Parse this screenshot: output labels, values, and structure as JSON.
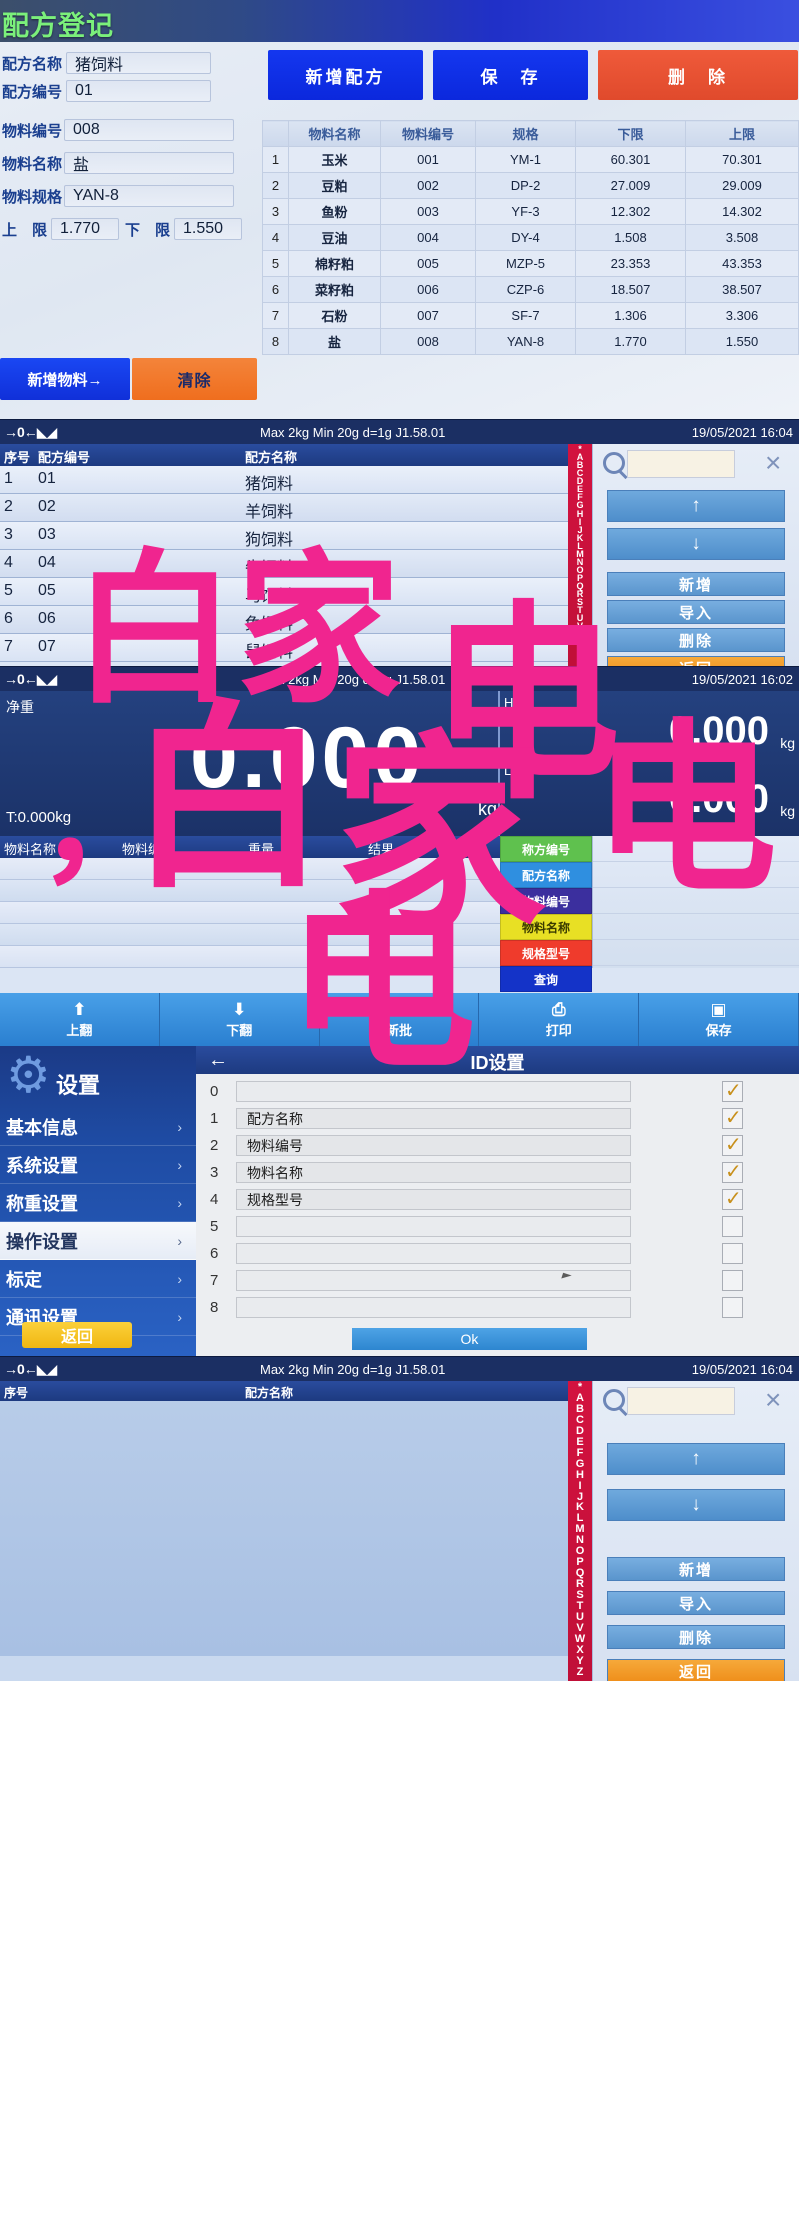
{
  "panel1": {
    "title": "配方登记",
    "fields": {
      "recipe_name_label": "配方名称",
      "recipe_name_value": "猪饲料",
      "recipe_code_label": "配方编号",
      "recipe_code_value": "01",
      "mat_code_label": "物料编号",
      "mat_code_value": "008",
      "mat_name_label": "物料名称",
      "mat_name_value": "盐",
      "mat_spec_label": "物料规格",
      "mat_spec_value": "YAN-8",
      "upper_label": "上　限",
      "upper_value": "1.770",
      "lower_label": "下　限",
      "lower_value": "1.550"
    },
    "buttons": {
      "new_recipe": "新增配方",
      "save": "保　存",
      "delete": "删　除",
      "new_material": "新增物料→",
      "clear": "清除"
    },
    "table": {
      "headers": [
        "",
        "物料名称",
        "物料编号",
        "规格",
        "下限",
        "上限"
      ],
      "rows": [
        [
          "1",
          "玉米",
          "001",
          "YM-1",
          "60.301",
          "70.301"
        ],
        [
          "2",
          "豆粕",
          "002",
          "DP-2",
          "27.009",
          "29.009"
        ],
        [
          "3",
          "鱼粉",
          "003",
          "YF-3",
          "12.302",
          "14.302"
        ],
        [
          "4",
          "豆油",
          "004",
          "DY-4",
          "1.508",
          "3.508"
        ],
        [
          "5",
          "棉籽粕",
          "005",
          "MZP-5",
          "23.353",
          "43.353"
        ],
        [
          "6",
          "菜籽粕",
          "006",
          "CZP-6",
          "18.507",
          "38.507"
        ],
        [
          "7",
          "石粉",
          "007",
          "SF-7",
          "1.306",
          "3.306"
        ],
        [
          "8",
          "盐",
          "008",
          "YAN-8",
          "1.770",
          "1.550"
        ]
      ]
    }
  },
  "statusbar": {
    "zero_icon": "→0←◣◢",
    "spec": "Max 2kg  Min 20g  d=1g    J1.58.01",
    "datetime": "19/05/2021  16:04",
    "datetime2": "19/05/2021  16:02"
  },
  "panel2": {
    "headers": {
      "seq": "序号",
      "code": "配方编号",
      "name": "配方名称"
    },
    "rows": [
      [
        "1",
        "01",
        "猪饲料"
      ],
      [
        "2",
        "02",
        "羊饲料"
      ],
      [
        "3",
        "03",
        "狗饲料"
      ],
      [
        "4",
        "04",
        "牛饲料"
      ],
      [
        "5",
        "05",
        "马饲料"
      ],
      [
        "6",
        "06",
        "兔饲料"
      ],
      [
        "7",
        "07",
        "鼠饲料"
      ]
    ],
    "alphabet": "*ABCDEFGHIJKLMNOPQRSTUVWXYZ",
    "search_value": "",
    "buttons": {
      "up": "↑",
      "down": "↓",
      "add": "新增",
      "import": "导入",
      "delete": "删除",
      "back": "返回"
    }
  },
  "panel3": {
    "net_label": "净重",
    "tare": "T:0.000kg",
    "weight": "0.000",
    "unit": "kg",
    "hi_label": "HI",
    "hi_value": "0.000",
    "hi_unit": "kg",
    "low_label": "LOW",
    "low_value": "0.000",
    "low_unit": "kg",
    "table_headers": [
      "物料名称",
      "物料编号",
      "重量",
      "结果"
    ],
    "side_buttons": [
      {
        "label": "称方编号",
        "color": "#5fc14e"
      },
      {
        "label": "配方名称",
        "color": "#2f8fe0"
      },
      {
        "label": "物料编号",
        "color": "#3b2f9e"
      },
      {
        "label": "物料名称",
        "color": "#e8e024"
      },
      {
        "label": "规格型号",
        "color": "#ef3b2c"
      },
      {
        "label": "查询",
        "color": "#1433c8"
      }
    ],
    "bottom_buttons": [
      {
        "icon": "⬆",
        "label": "上翻"
      },
      {
        "icon": "⬇",
        "label": "下翻"
      },
      {
        "icon": "▲",
        "label": "新批"
      },
      {
        "icon": "⎙",
        "label": "打印"
      },
      {
        "icon": "▣",
        "label": "保存"
      }
    ]
  },
  "panel4": {
    "sidebar_title": "设置",
    "sidebar_items": [
      "基本信息",
      "系统设置",
      "称重设置",
      "操作设置",
      "标定",
      "通讯设置"
    ],
    "sidebar_active": "操作设置",
    "back_button": "返回",
    "header_title": "ID设置",
    "rows": [
      {
        "num": "0",
        "value": "",
        "checked": true
      },
      {
        "num": "1",
        "value": "配方名称",
        "checked": true
      },
      {
        "num": "2",
        "value": "物料编号",
        "checked": true
      },
      {
        "num": "3",
        "value": "物料名称",
        "checked": true
      },
      {
        "num": "4",
        "value": "规格型号",
        "checked": true
      },
      {
        "num": "5",
        "value": "",
        "checked": false
      },
      {
        "num": "6",
        "value": "",
        "checked": false
      },
      {
        "num": "7",
        "value": "",
        "checked": false
      },
      {
        "num": "8",
        "value": "",
        "checked": false
      }
    ],
    "ok_button": "Ok"
  },
  "panel5": {
    "headers": {
      "seq": "序号",
      "name": "配方名称"
    },
    "alphabet": "*ABCDEFGHIJKLMNOPQRSTUVWXYZ",
    "buttons": {
      "up": "↑",
      "down": "↓",
      "add": "新增",
      "import": "导入",
      "delete": "删除",
      "back": "返回"
    }
  },
  "watermark": {
    "text": "白家电，白家电"
  }
}
